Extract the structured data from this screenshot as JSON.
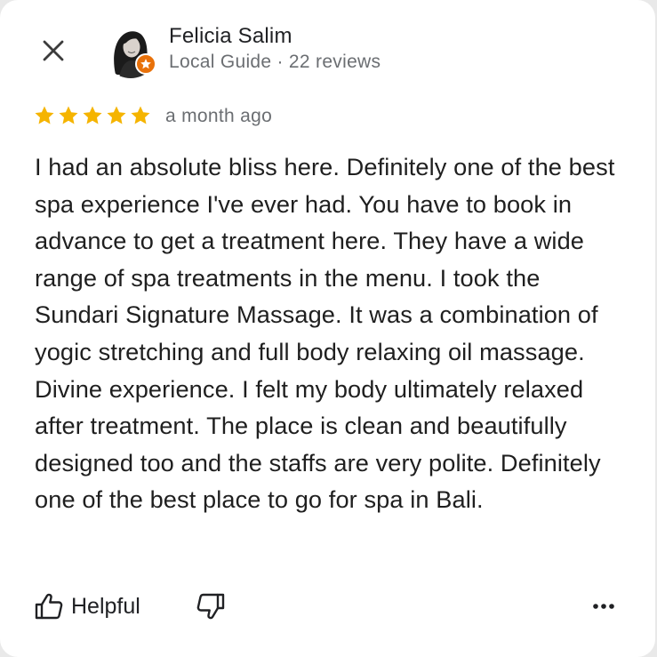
{
  "reviewer": {
    "name": "Felicia Salim",
    "meta": "Local Guide · 22 reviews"
  },
  "review": {
    "rating": 5,
    "time": "a month ago",
    "text": "I had an absolute bliss here. Definitely one of the best spa experience I've ever had. You have to book in advance to get a treatment here. They have a wide range of spa treatments in the menu. I took the Sundari Signature Massage. It was a combination of yogic stretching and full body relaxing oil massage. Divine experience. I felt my body ultimately relaxed after treatment. The place is clean and beautifully designed too and the staffs are very polite. Definitely one of the best place to go for spa in Bali."
  },
  "actions": {
    "helpful_label": "Helpful"
  },
  "icons": {
    "close": "close-icon",
    "avatar": "avatar",
    "badge": "local-guide-star-icon",
    "star": "star-icon",
    "thumbs_up": "thumbs-up-icon",
    "thumbs_down": "thumbs-down-icon",
    "more": "more-horizontal-icon"
  },
  "colors": {
    "star": "#f5b400",
    "badge": "#e8710a",
    "text_primary": "#1f1f1f",
    "text_secondary": "#6b6e72"
  }
}
